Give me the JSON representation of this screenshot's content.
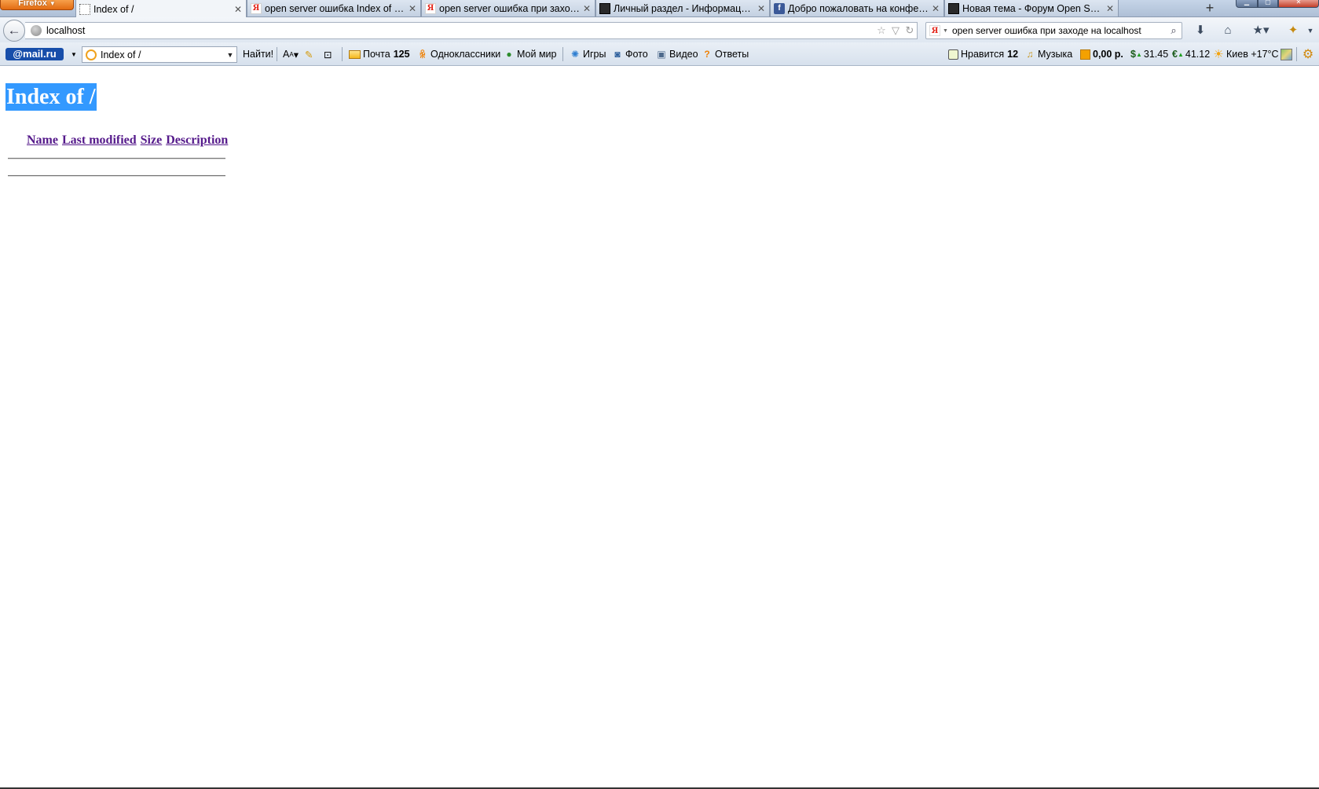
{
  "browser": {
    "app_button": "Firefox",
    "tabs": [
      {
        "title": "Index of /",
        "active": true,
        "favicon": "blank-page-icon"
      },
      {
        "title": "open server ошибка Index of / — Я...",
        "active": false,
        "favicon": "yandex-icon"
      },
      {
        "title": "open server ошибка при заходе на...",
        "active": false,
        "favicon": "yandex-icon"
      },
      {
        "title": "Личный раздел - Информация - ...",
        "active": false,
        "favicon": "dark-site-icon"
      },
      {
        "title": "Добро пожаловать на конференц...",
        "active": false,
        "favicon": "facebook-icon"
      },
      {
        "title": "Новая тема - Форум Open Server",
        "active": false,
        "favicon": "dark-site-icon"
      }
    ],
    "new_tab": "+",
    "address": "localhost",
    "search": {
      "engine": "Я",
      "value": "open server ошибка при заходе на localhost"
    }
  },
  "mailru_toolbar": {
    "logo": "@mail.ru",
    "search_combo_value": "Index of /",
    "find_button": "Найти!",
    "links": {
      "mail_label": "Почта",
      "mail_count": "125",
      "odnoklassniki": "Одноклассники",
      "my_world": "Мой мир",
      "games": "Игры",
      "photo": "Фото",
      "video": "Видео",
      "answers": "Ответы",
      "likes_label": "Нравится",
      "likes_count": "12",
      "music": "Музыка",
      "money": "0,00 р.",
      "usd_rate": "31.45",
      "eur_rate": "41.12",
      "weather": "Киев +17°C"
    }
  },
  "page": {
    "title": "Index of /",
    "columns": [
      "Name",
      "Last modified",
      "Size",
      "Description"
    ],
    "link_color": "#551a8b",
    "selection_color": "#3399ff"
  }
}
